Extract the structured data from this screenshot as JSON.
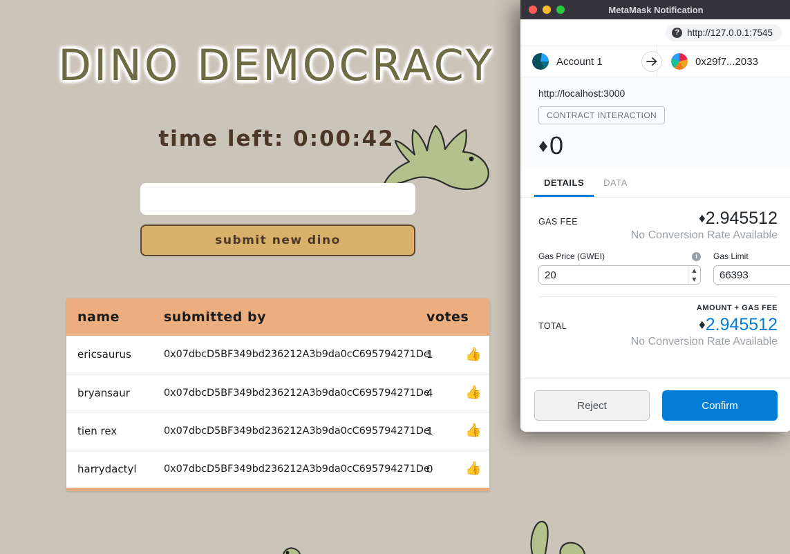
{
  "dapp": {
    "title": "DINO DEMOCRACY",
    "timer_label": "time left: 0:00:42",
    "input_value": "",
    "input_placeholder": "",
    "submit_label": "submit new dino",
    "colors": {
      "background": "#cbc4b9",
      "title": "#6d6c45",
      "table_header": "#edae7f",
      "submit_button": "#d9b06a",
      "dino_body": "#b4c18d"
    },
    "table": {
      "columns": [
        "name",
        "submitted by",
        "votes",
        ""
      ],
      "rows": [
        {
          "name": "ericsaurus",
          "submitted_by": "0x07dbcD5BF349bd236212A3b9da0cC695794271De",
          "votes": "1",
          "vote_icon": "thumbs-up-icon"
        },
        {
          "name": "bryansaur",
          "submitted_by": "0x07dbcD5BF349bd236212A3b9da0cC695794271De",
          "votes": "4",
          "vote_icon": "thumbs-up-icon"
        },
        {
          "name": "tien rex",
          "submitted_by": "0x07dbcD5BF349bd236212A3b9da0cC695794271De",
          "votes": "1",
          "vote_icon": "thumbs-up-icon"
        },
        {
          "name": "harrydactyl",
          "submitted_by": "0x07dbcD5BF349bd236212A3b9da0cC695794271De",
          "votes": "0",
          "vote_icon": "thumbs-up-icon"
        }
      ]
    }
  },
  "metamask": {
    "window_title": "MetaMask Notification",
    "traffic_lights": [
      "close-button",
      "minimize-button",
      "maximize-button"
    ],
    "network": {
      "icon": "question-mark-icon",
      "url": "http://127.0.0.1:7545"
    },
    "accounts": {
      "from": {
        "name": "Account 1",
        "avatar": "jazzicon-avatar"
      },
      "arrow": "arrow-right-icon",
      "to": {
        "name": "0x29f7...2033",
        "avatar": "jazzicon-avatar"
      }
    },
    "transaction": {
      "origin": "http://localhost:3000",
      "type_badge": "CONTRACT INTERACTION",
      "amount": "0",
      "eth_symbol": "♦"
    },
    "tabs": [
      {
        "label": "DETAILS",
        "active": true
      },
      {
        "label": "DATA",
        "active": false
      }
    ],
    "details": {
      "gas_fee_label": "GAS FEE",
      "gas_fee_amount": "2.945512",
      "gas_fee_note": "No Conversion Rate Available",
      "gas_price": {
        "label": "Gas Price (GWEI)",
        "value": "20",
        "info": "info-icon"
      },
      "gas_limit": {
        "label": "Gas Limit",
        "value": "66393",
        "info": "info-icon"
      },
      "amount_gas_label": "AMOUNT + GAS FEE",
      "total_label": "TOTAL",
      "total_amount": "2.945512",
      "total_note": "No Conversion Rate Available",
      "total_color": "#037dd6"
    },
    "footer": {
      "reject_label": "Reject",
      "confirm_label": "Confirm"
    }
  }
}
